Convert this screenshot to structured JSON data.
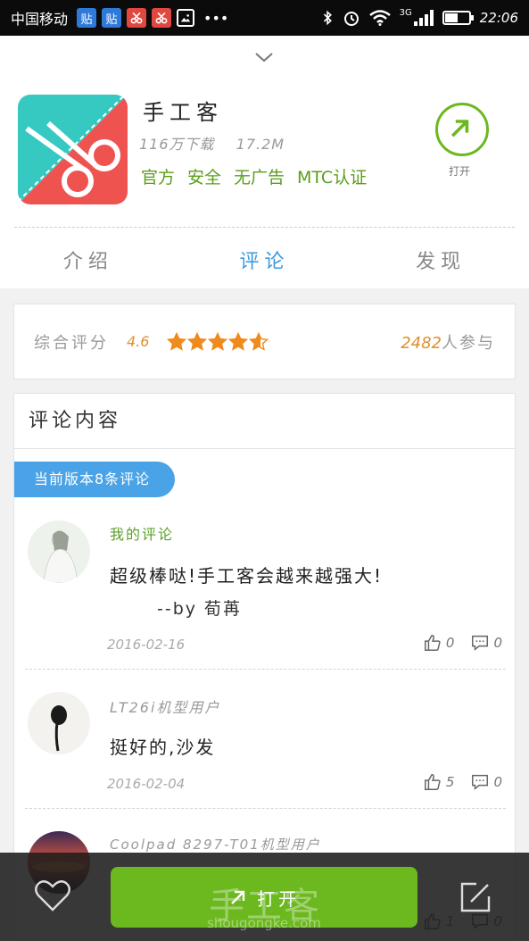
{
  "status_bar": {
    "carrier": "中国移动",
    "badges": [
      "贴",
      "贴"
    ],
    "network": "3G",
    "battery_level": 0.55,
    "time": "22:06"
  },
  "app": {
    "name": "手工客",
    "downloads": "116万下载",
    "size": "17.2M",
    "tags": [
      "官方",
      "安全",
      "无广告",
      "MTC认证"
    ],
    "open_label": "打开",
    "icon_colors": {
      "teal": "#35c9c1",
      "red": "#ef5350"
    }
  },
  "tabs": [
    {
      "label": "介绍",
      "active": false
    },
    {
      "label": "评论",
      "active": true
    },
    {
      "label": "发现",
      "active": false
    }
  ],
  "rating": {
    "label": "综合评分",
    "score": "4.6",
    "stars": 4.6,
    "participants_count": "2482",
    "participants_suffix": "人参与"
  },
  "comments_section": {
    "title": "评论内容",
    "version_badge": "当前版本8条评论",
    "items": [
      {
        "user": "我的评论",
        "text": "超级棒哒!手工客会越来越强大!",
        "signature": "--by 荀苒",
        "date": "2016-02-16",
        "likes": "0",
        "replies": "0"
      },
      {
        "user": "LT26i机型用户",
        "text": "挺好的,沙发",
        "date": "2016-02-04",
        "likes": "5",
        "replies": "0"
      },
      {
        "user": "Coolpad 8297-T01机型用户",
        "likes": "1",
        "replies": "0"
      }
    ]
  },
  "bottom_bar": {
    "open_button": "打开"
  },
  "watermark": {
    "text": "手工客",
    "url": "shougongke.com"
  },
  "colors": {
    "accent_green": "#6cb81f",
    "tab_blue": "#3a9be0",
    "rating_orange": "#e0902a",
    "star_orange": "#f08a1c"
  }
}
